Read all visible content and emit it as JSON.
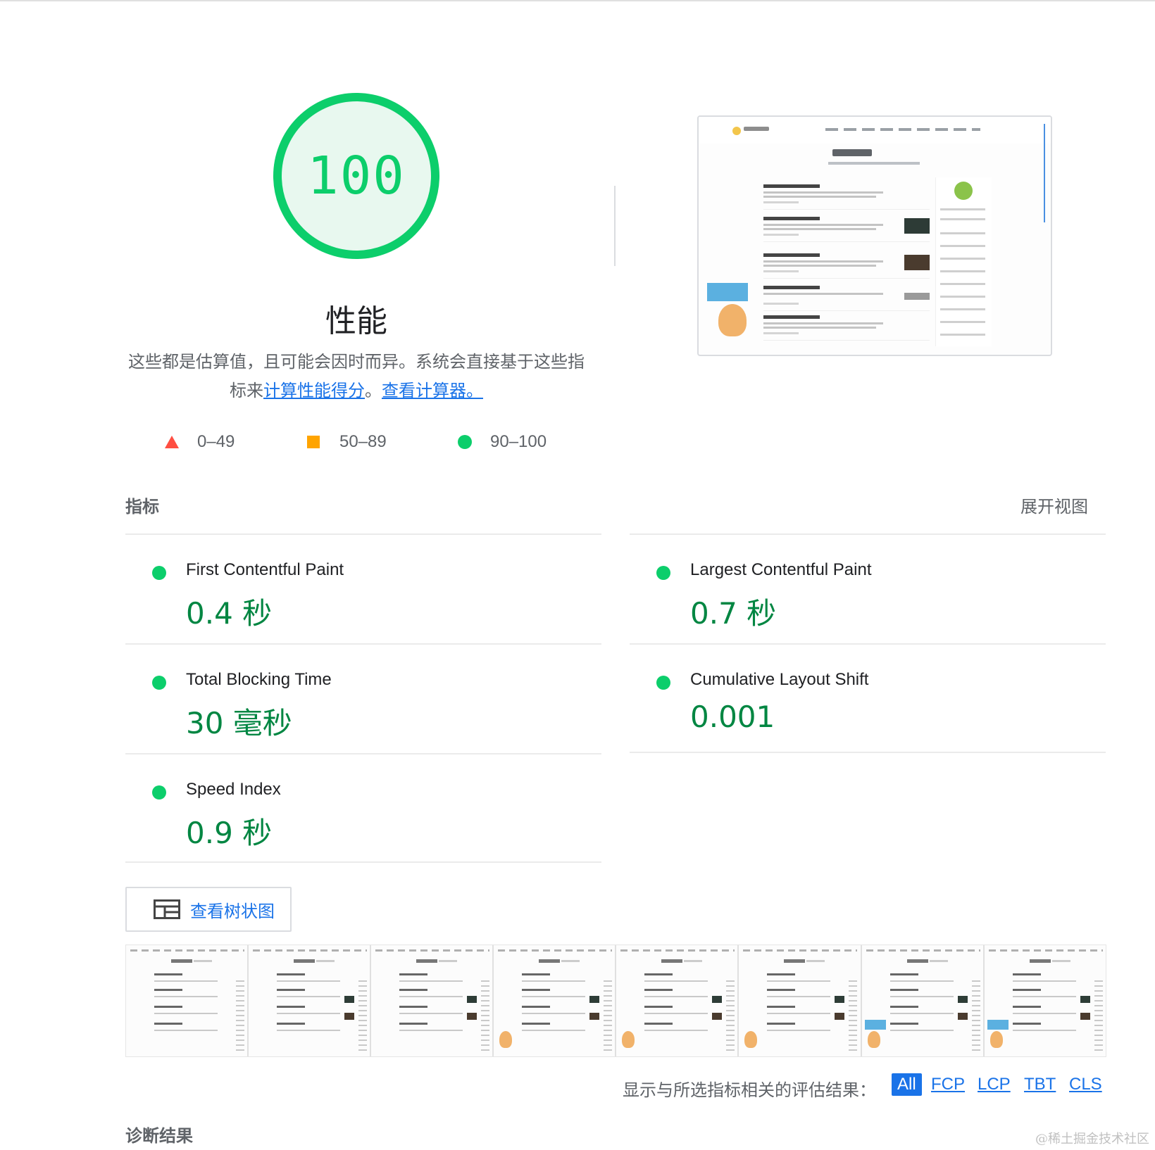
{
  "gauge": {
    "score": "100",
    "score_fraction": 1.0,
    "color": "#0cce6b",
    "title": "性能",
    "description_text": "这些都是估算值，且可能会因时而异。系统会直接基于这些指标来",
    "link_calc_score": "计算性能得分",
    "separator": "。",
    "link_calculator": "查看计算器。"
  },
  "legend": [
    {
      "label": "0–49",
      "shape": "triangle",
      "color": "#ff4e42"
    },
    {
      "label": "50–89",
      "shape": "square",
      "color": "#ffa400"
    },
    {
      "label": "90–100",
      "shape": "circle",
      "color": "#0cce6b"
    }
  ],
  "metrics": {
    "header": "指标",
    "expand_label": "展开视图",
    "items": [
      {
        "name": "First Contentful Paint",
        "value": "0.4 秒",
        "status": "pass"
      },
      {
        "name": "Largest Contentful Paint",
        "value": "0.7 秒",
        "status": "pass"
      },
      {
        "name": "Total Blocking Time",
        "value": "30 毫秒",
        "status": "pass"
      },
      {
        "name": "Cumulative Layout Shift",
        "value": "0.001",
        "status": "pass"
      },
      {
        "name": "Speed Index",
        "value": "0.9 秒",
        "status": "pass"
      }
    ]
  },
  "treemap": {
    "label": "查看树状图",
    "icon": "treemap-icon"
  },
  "filter": {
    "label": "显示与所选指标相关的评估结果：",
    "options": [
      "All",
      "FCP",
      "LCP",
      "TBT",
      "CLS"
    ],
    "selected": "All"
  },
  "diagnostics": {
    "header": "诊断结果"
  },
  "watermark": "@稀土掘金技术社区",
  "colors": {
    "pass": "#0cce6b",
    "pass_text": "#018642",
    "link": "#1a73e8"
  }
}
